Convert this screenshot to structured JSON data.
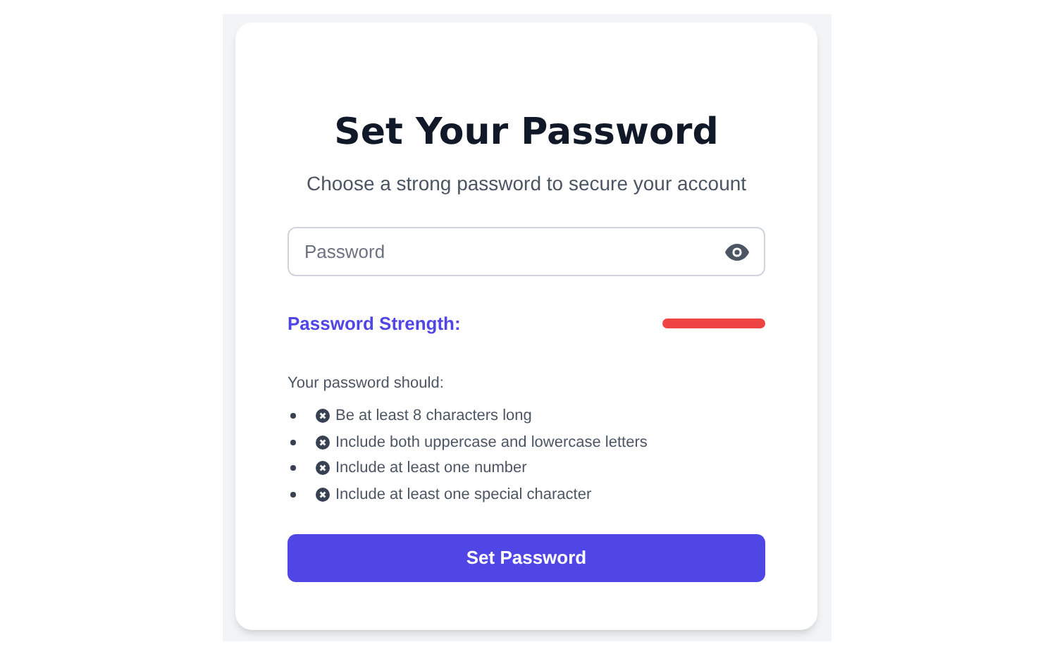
{
  "title": "Set Your Password",
  "subtitle": "Choose a strong password to secure your account",
  "password_field": {
    "placeholder": "Password"
  },
  "strength": {
    "label": "Password Strength:"
  },
  "requirements": {
    "heading": "Your password should:",
    "items": [
      {
        "text": "Be at least 8 characters long",
        "met": false
      },
      {
        "text": "Include both uppercase and lowercase letters",
        "met": false
      },
      {
        "text": "Include at least one number",
        "met": false
      },
      {
        "text": "Include at least one special character",
        "met": false
      }
    ]
  },
  "button": "Set Password"
}
